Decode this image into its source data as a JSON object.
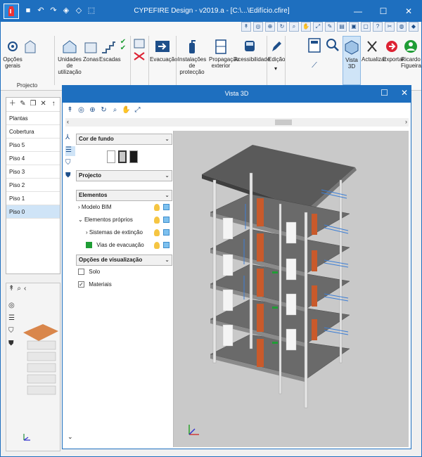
{
  "app": {
    "title": "CYPEFIRE Design - v2019.a - [C:\\...\\Edifício.cfire]",
    "window_controls": [
      "minimize",
      "maximize",
      "close"
    ]
  },
  "ribbon": {
    "buttons": [
      {
        "id": "opcoes",
        "label": "Opções gerais"
      },
      {
        "id": "unidades",
        "label": "Unidades de utilização"
      },
      {
        "id": "zonas",
        "label": "Zonas"
      },
      {
        "id": "escadas",
        "label": "Escadas"
      },
      {
        "id": "evacuacao",
        "label": "Evacuação"
      },
      {
        "id": "instalacoes",
        "label": "Instalações de protecção"
      },
      {
        "id": "propagacao",
        "label": "Propagação exterior"
      },
      {
        "id": "acessibilidade",
        "label": "Acessibilidade"
      },
      {
        "id": "edicao",
        "label": "Edição"
      },
      {
        "id": "vista3d",
        "label": "Vista 3D"
      },
      {
        "id": "actualizar",
        "label": "Actualizar"
      },
      {
        "id": "exportar",
        "label": "Exportar"
      },
      {
        "id": "user",
        "label": "Ricardo Figueira"
      }
    ],
    "group_label": "Projecto"
  },
  "left_panel": {
    "floors": [
      "Plantas",
      "Cobertura",
      "Piso 5",
      "Piso 4",
      "Piso 3",
      "Piso 2",
      "Piso 1",
      "Piso 0"
    ],
    "selected": "Piso 0"
  },
  "dialog": {
    "title": "Vista 3D",
    "background_section": "Cor de fundo",
    "background_colors": [
      "#ffffff",
      "#c8c8c8",
      "#1a1a1a"
    ],
    "project_section": "Projecto",
    "elements_section": "Elementos",
    "elements": [
      {
        "label": "Modelo BIM",
        "level": 0
      },
      {
        "label": "Elementos próprios",
        "level": 0
      },
      {
        "label": "Sistemas de extinção",
        "level": 1
      },
      {
        "label": "Vias de evacuação",
        "level": 1
      }
    ],
    "view_section": "Opções de visualização",
    "view_options": [
      {
        "label": "Solo",
        "checked": false
      },
      {
        "label": "Materiais",
        "checked": true
      }
    ]
  },
  "colors": {
    "title_blue": "#1e6fbf",
    "selection": "#cfe4f7",
    "evacuation_green": "#1f9d35"
  }
}
